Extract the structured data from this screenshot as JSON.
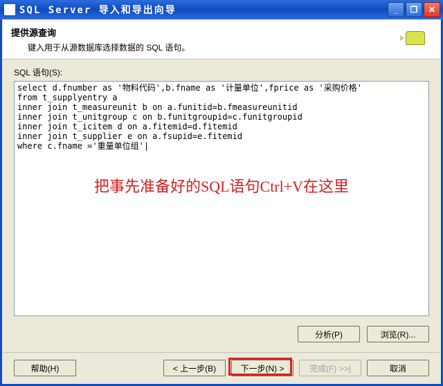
{
  "window": {
    "title": "SQL Server 导入和导出向导"
  },
  "header": {
    "title": "提供源查询",
    "subtitle": "键入用于从源数据库选择数据的 SQL 语句。"
  },
  "field": {
    "label": "SQL 语句(S):",
    "sql_text": "select d.fnumber as '物料代码',b.fname as '计量单位',fprice as '采购价格'\nfrom t_supplyentry a\ninner join t_measureunit b on a.funitid=b.fmeasureunitid\ninner join t_unitgroup c on b.funitgroupid=c.funitgroupid\ninner join t_icitem d on a.fitemid=d.fitemid\ninner join t_supplier e on a.fsupid=e.fitemid\nwhere c.fname ='重量单位组'|"
  },
  "overlay": {
    "note": "把事先准备好的SQL语句Ctrl+V在这里"
  },
  "buttons": {
    "analyze": "分析(P)",
    "browse": "浏览(R)...",
    "help": "帮助(H)",
    "back": "< 上一步(B)",
    "next": "下一步(N) >",
    "finish": "完成(F) >>|",
    "cancel": "取消"
  }
}
